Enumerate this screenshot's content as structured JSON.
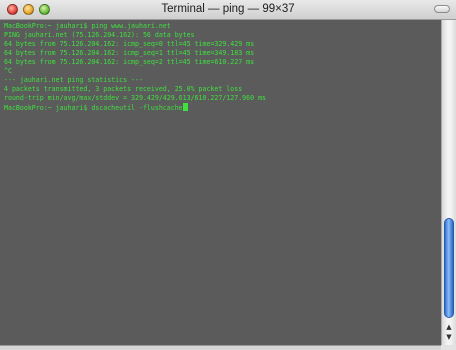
{
  "window": {
    "title": "Terminal — ping — 99×37"
  },
  "colors": {
    "background": "#5b5b5b",
    "text": "#3fe03f",
    "scroll_thumb": "#4a86e0"
  },
  "icons": {
    "close": "close-traffic-light",
    "minimize": "minimize-traffic-light",
    "zoom": "zoom-traffic-light",
    "toolbar": "toolbar-toggle-pill",
    "scroll_up": "up-arrow",
    "scroll_down": "down-arrow"
  },
  "terminal": {
    "lines": [
      "MacBookPro:~ jauhari$ ping www.jauhari.net",
      "PING jauhari.net (75.126.204.162): 56 data bytes",
      "64 bytes from 75.126.204.162: icmp_seq=0 ttl=45 time=329.429 ms",
      "64 bytes from 75.126.204.162: icmp_seq=1 ttl=45 time=349.183 ms",
      "64 bytes from 75.126.204.162: icmp_seq=2 ttl=45 time=610.227 ms",
      "^C",
      "--- jauhari.net ping statistics ---",
      "4 packets transmitted, 3 packets received, 25.0% packet loss",
      "round-trip min/avg/max/stddev = 329.429/429.613/610.227/127.960 ms",
      "MacBookPro:~ jauhari$ dscacheutil -flushcache"
    ]
  },
  "scrollbar": {
    "position_fraction": 0.85,
    "visible_fraction": 0.33
  }
}
